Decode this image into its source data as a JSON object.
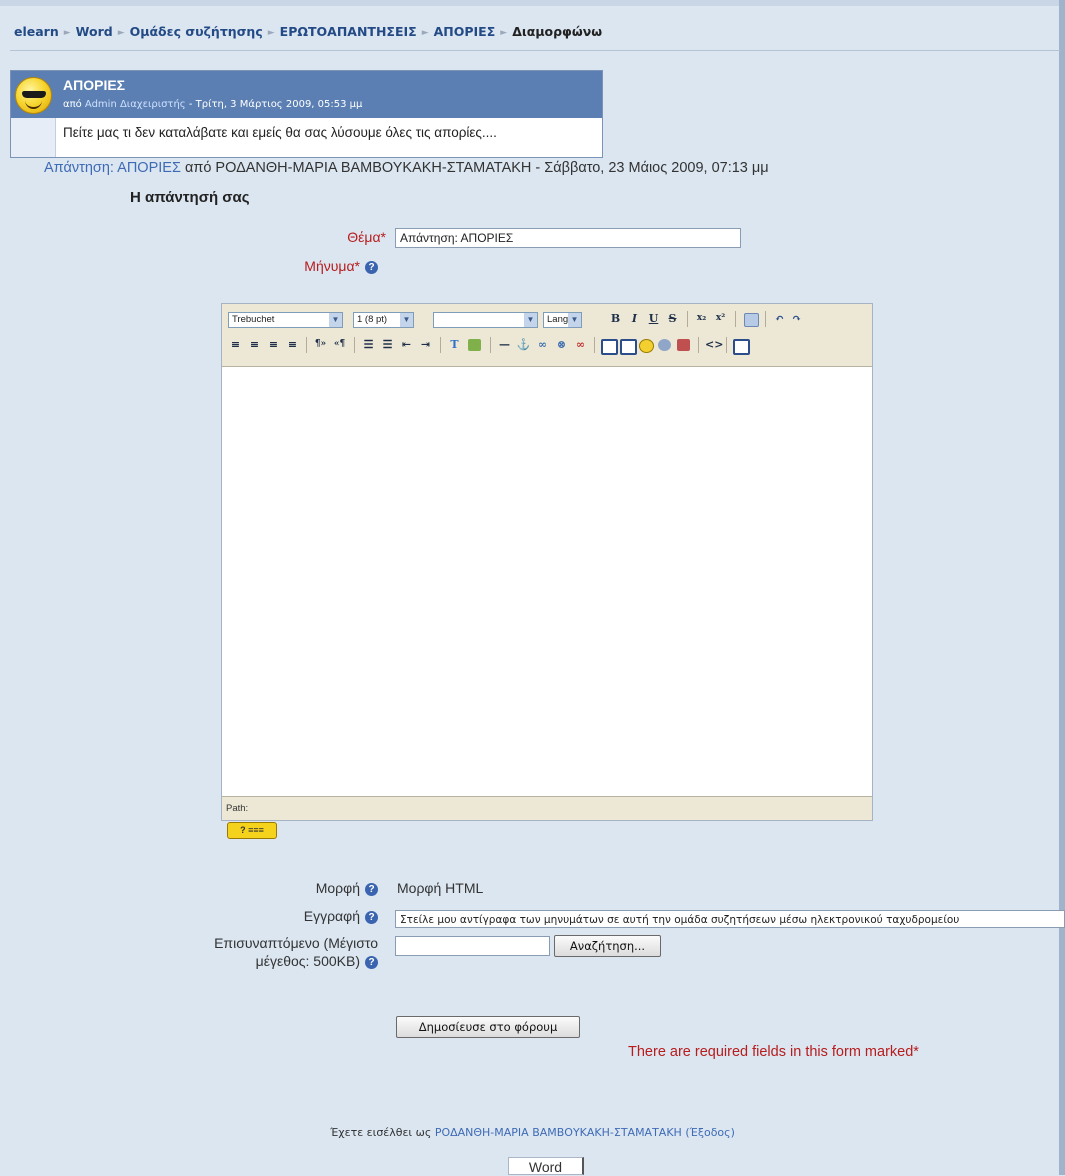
{
  "breadcrumb": {
    "items": [
      "elearn",
      "Word",
      "Ομάδες συζήτησης",
      "ΕΡΩΤΟΑΠΑΝΤΗΣΕΙΣ",
      "ΑΠΟΡΙΕΣ"
    ],
    "current": "Διαμορφώνω",
    "separator": "►"
  },
  "post": {
    "subject": "ΑΠΟΡΙΕΣ",
    "by_prefix": "από",
    "author": "Admin Διαχειριστής",
    "date": " - Τρίτη, 3 Μάρτιος 2009, 05:53 μμ",
    "message": "Πείτε μας τι δεν καταλάβατε και εμείς θα σας λύσουμε όλες τις απορίες....",
    "avatar_icon": "smiley-sunglasses-icon"
  },
  "reply_line": {
    "prefix": "Απάντηση: ΑΠΟΡΙΕΣ",
    "text": " από ΡΟΔΑΝΘΗ-ΜΑΡΙΑ ΒΑΜΒΟΥΚΑΚΗ-ΣΤΑΜΑΤΑΚΗ - Σάββατο, 23 Μάιος 2009, 07:13 μμ"
  },
  "form": {
    "heading": "Η απάντησή σας",
    "subject_label": "Θέμα",
    "subject_value": "Απάντηση: ΑΠΟΡΙΕΣ",
    "message_label": "Μήνυμα",
    "required_mark": "*",
    "help_symbol": "?",
    "format_label": "Μορφή",
    "format_value": "Μορφή HTML",
    "subscribe_label": "Εγγραφή",
    "subscribe_value": "Στείλε μου αντίγραφα των μηνυμάτων σε αυτή την ομάδα συζητήσεων μέσω ηλεκτρονικού ταχυδρομείου",
    "attachment_label_1": "Επισυναπτόμενο (Μέγιστο",
    "attachment_label_2": "μέγεθος: 500KB)",
    "browse_button": "Αναζήτηση...",
    "submit_button": "Δημοσίευσε στο φόρουμ",
    "required_note": "There are required fields in this form marked",
    "help_badge": "? ≡≡≡"
  },
  "editor": {
    "font_family": "Trebuchet",
    "font_size": "1 (8 pt)",
    "heading_select": "",
    "lang_select": "Lang",
    "path_label": "Path:",
    "toolbar_icons": [
      "bold-icon",
      "italic-icon",
      "underline-icon",
      "strikethrough-icon",
      "subscript-icon",
      "superscript-icon",
      "clean-icon",
      "undo-icon",
      "redo-icon",
      "align-left-icon",
      "align-center-icon",
      "align-right-icon",
      "justify-icon",
      "ltr-icon",
      "rtl-icon",
      "ordered-list-icon",
      "unordered-list-icon",
      "outdent-icon",
      "indent-icon",
      "text-color-icon",
      "bg-color-icon",
      "horizontal-rule-icon",
      "anchor-icon",
      "link-icon",
      "unlink-icon",
      "nolink-icon",
      "image-icon",
      "table-icon",
      "smiley-icon",
      "special-char-icon",
      "search-replace-icon",
      "html-source-icon",
      "fullscreen-icon"
    ]
  },
  "footer": {
    "logged_in_prefix": "Έχετε εισέλθει ως",
    "user": "ΡΟΔΑΝΘΗ-ΜΑΡΙΑ ΒΑΜΒΟΥΚΑΚΗ-ΣΤΑΜΑΤΑΚΗ",
    "logout": "(Έξοδος)",
    "course_link": "Word"
  }
}
